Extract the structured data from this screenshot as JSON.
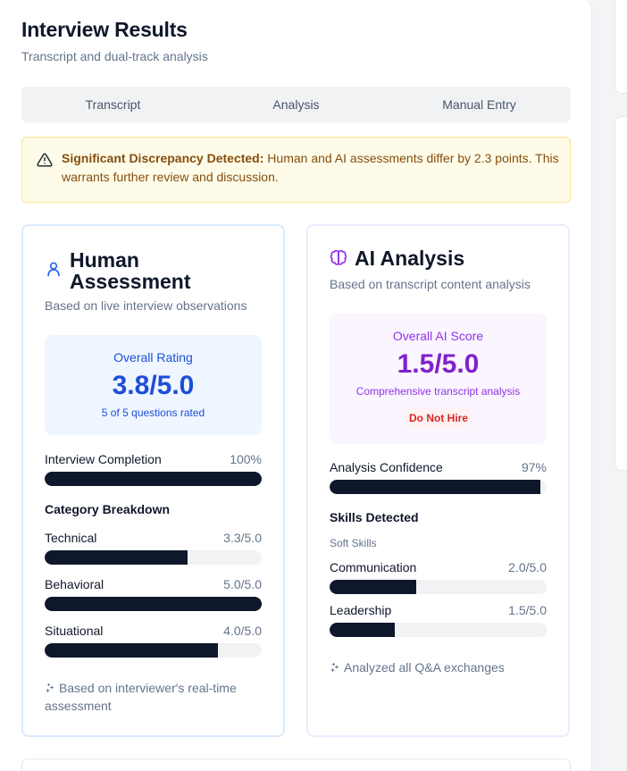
{
  "header": {
    "title": "Interview Results",
    "subtitle": "Transcript and dual-track analysis"
  },
  "tabs": [
    {
      "label": "Transcript"
    },
    {
      "label": "Analysis"
    },
    {
      "label": "Manual Entry"
    }
  ],
  "alert": {
    "heading": "Significant Discrepancy Detected:",
    "message": " Human and AI assessments differ by 2.3 points. This warrants further review and discussion.",
    "icon": "warning-triangle-icon"
  },
  "human": {
    "title": "Human Assessment",
    "subtitle": "Based on live interview observations",
    "icon": "user-icon",
    "accent": "#1d4ed8",
    "score_label": "Overall Rating",
    "score": "3.8/5.0",
    "score_note": "5 of 5 questions rated",
    "completion_label": "Interview Completion",
    "completion_value": "100%",
    "completion_fraction": 1.0,
    "breakdown_heading": "Category Breakdown",
    "categories": [
      {
        "label": "Technical",
        "value": "3.3/5.0",
        "fraction": 0.66
      },
      {
        "label": "Behavioral",
        "value": "5.0/5.0",
        "fraction": 1.0
      },
      {
        "label": "Situational",
        "value": "4.0/5.0",
        "fraction": 0.8
      }
    ],
    "footnote": "Based on interviewer's real-time assessment"
  },
  "ai": {
    "title": "AI Analysis",
    "subtitle": "Based on transcript content analysis",
    "icon": "brain-icon",
    "accent": "#7e22ce",
    "score_label": "Overall AI Score",
    "score": "1.5/5.0",
    "score_note": "Comprehensive transcript analysis",
    "verdict": "Do Not Hire",
    "confidence_label": "Analysis Confidence",
    "confidence_value": "97%",
    "confidence_fraction": 0.97,
    "skills_heading": "Skills Detected",
    "skills_group": "Soft Skills",
    "skills": [
      {
        "label": "Communication",
        "value": "2.0/5.0",
        "fraction": 0.4
      },
      {
        "label": "Leadership",
        "value": "1.5/5.0",
        "fraction": 0.3
      }
    ],
    "footnote": "Analyzed all Q&A exchanges"
  }
}
